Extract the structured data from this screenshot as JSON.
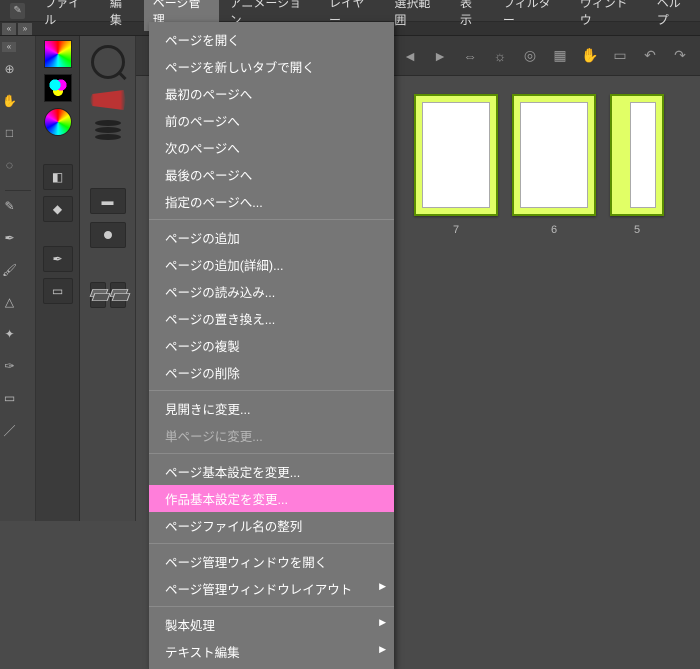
{
  "menubar": {
    "items": [
      "ファイル",
      "編集",
      "ページ管理",
      "アニメーション",
      "レイヤー",
      "選択範囲",
      "表示",
      "フィルター",
      "ウィンドウ",
      "ヘルプ"
    ],
    "open_index": 2
  },
  "dropdown": {
    "groups": [
      [
        {
          "label": "ページを開く",
          "enabled": true
        },
        {
          "label": "ページを新しいタブで開く",
          "enabled": true
        },
        {
          "label": "最初のページへ",
          "enabled": true
        },
        {
          "label": "前のページへ",
          "enabled": true
        },
        {
          "label": "次のページへ",
          "enabled": true
        },
        {
          "label": "最後のページへ",
          "enabled": true
        },
        {
          "label": "指定のページへ...",
          "enabled": true
        }
      ],
      [
        {
          "label": "ページの追加",
          "enabled": true
        },
        {
          "label": "ページの追加(詳細)...",
          "enabled": true
        },
        {
          "label": "ページの読み込み...",
          "enabled": true
        },
        {
          "label": "ページの置き換え...",
          "enabled": true
        },
        {
          "label": "ページの複製",
          "enabled": true
        },
        {
          "label": "ページの削除",
          "enabled": true
        }
      ],
      [
        {
          "label": "見開きに変更...",
          "enabled": true
        },
        {
          "label": "単ページに変更...",
          "enabled": false
        }
      ],
      [
        {
          "label": "ページ基本設定を変更...",
          "enabled": true
        },
        {
          "label": "作品基本設定を変更...",
          "enabled": true,
          "highlight": true
        },
        {
          "label": "ページファイル名の整列",
          "enabled": true
        }
      ],
      [
        {
          "label": "ページ管理ウィンドウを開く",
          "enabled": true
        },
        {
          "label": "ページ管理ウィンドウレイアウト",
          "enabled": true,
          "submenu": true
        }
      ],
      [
        {
          "label": "製本処理",
          "enabled": true,
          "submenu": true
        },
        {
          "label": "テキスト編集",
          "enabled": true,
          "submenu": true
        }
      ]
    ]
  },
  "toolbar_top_icons": [
    "nav-left",
    "nav-right",
    "scroll",
    "sun-icon",
    "target",
    "grid",
    "hand-icon",
    "page-icon",
    "rotate-left",
    "rotate-right"
  ],
  "pages": [
    {
      "num": "7"
    },
    {
      "num": "6"
    },
    {
      "num": "5"
    }
  ],
  "left_tools": {
    "group1": [
      {
        "name": "magnify-tool",
        "glyph": "⊕"
      },
      {
        "name": "hand-tool",
        "glyph": "✋"
      },
      {
        "name": "app-tool",
        "glyph": "□"
      },
      {
        "name": "lasso-tool",
        "glyph": "◌"
      }
    ],
    "group2": [
      {
        "name": "eyedropper-tool",
        "glyph": "✎"
      },
      {
        "name": "pen-tool",
        "glyph": "✒"
      },
      {
        "name": "brush-tool",
        "glyph": "🖌"
      },
      {
        "name": "bucket-tool",
        "glyph": "△"
      },
      {
        "name": "shape-tool",
        "glyph": "✦"
      },
      {
        "name": "path-tool",
        "glyph": "✑"
      },
      {
        "name": "eraser-tool",
        "glyph": "▭"
      },
      {
        "name": "line-tool",
        "glyph": "／"
      }
    ]
  }
}
